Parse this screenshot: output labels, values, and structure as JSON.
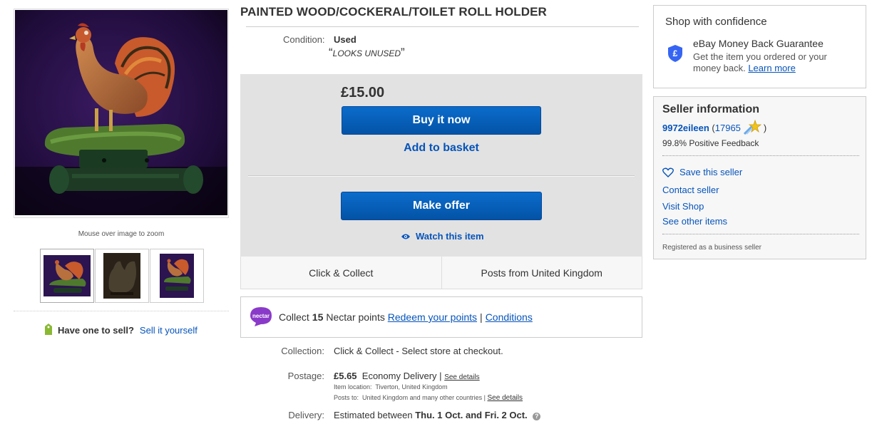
{
  "gallery": {
    "zoom_hint": "Mouse over image to zoom",
    "thumbnails": [
      "thumbnail-1",
      "thumbnail-2",
      "thumbnail-3"
    ]
  },
  "sell": {
    "question": "Have one to sell?",
    "link": "Sell it yourself"
  },
  "listing": {
    "title": "PAINTED WOOD/COCKERAL/TOILET ROLL HOLDER",
    "condition_label": "Condition:",
    "condition_value": "Used",
    "condition_note": "LOOKS UNUSED",
    "price": "£15.00",
    "buy_now": "Buy it now",
    "add_basket": "Add to basket",
    "make_offer": "Make offer",
    "watch": "Watch this item"
  },
  "delivery_options": [
    "Click & Collect",
    "Posts from United Kingdom"
  ],
  "nectar": {
    "prefix": "Collect",
    "points": "15",
    "suffix": "Nectar points",
    "redeem": "Redeem your points",
    "separator": "|",
    "conditions": "Conditions",
    "logo_text": "nectar"
  },
  "details": {
    "collection_label": "Collection:",
    "collection_value": "Click & Collect - Select store at checkout.",
    "postage_label": "Postage:",
    "postage_price": "£5.65",
    "postage_service": "Economy Delivery",
    "postage_sep": "|",
    "see_details": "See details",
    "item_location_label": "Item location:",
    "item_location_value": "Tiverton, United Kingdom",
    "posts_to_label": "Posts to:",
    "posts_to_value": "United Kingdom and many other countries",
    "posts_to_sep": "|",
    "see_details_2": "See details",
    "delivery_label": "Delivery:",
    "delivery_prefix": "Estimated between",
    "delivery_dates": "Thu. 1 Oct. and Fri. 2 Oct."
  },
  "confidence": {
    "title": "Shop with confidence",
    "guarantee": "eBay Money Back Guarantee",
    "text": "Get the item you ordered or your money back.",
    "learn_more": "Learn more",
    "shield_glyph": "£"
  },
  "seller": {
    "title": "Seller information",
    "username": "9972eileen",
    "open_paren": "(",
    "feedback_score": "17965",
    "close_paren": ")",
    "positive": "99.8% Positive Feedback",
    "save": "Save this seller",
    "contact": "Contact seller",
    "shop": "Visit Shop",
    "other": "See other items",
    "registered": "Registered as a business seller"
  },
  "colors": {
    "link": "#0654ba",
    "button": "#0654ba",
    "buy_box_bg": "#e2e2e2",
    "nectar": "#8a2be2"
  }
}
